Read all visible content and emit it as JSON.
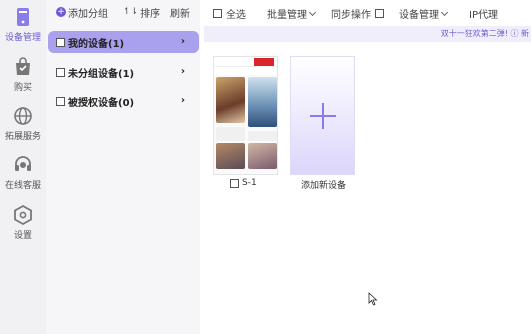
{
  "rail": {
    "items": [
      {
        "label": "设备管理",
        "icon": "phone-device-icon",
        "active": true
      },
      {
        "label": "购买",
        "icon": "shopping-bag-icon"
      },
      {
        "label": "拓展服务",
        "icon": "globe-icon"
      },
      {
        "label": "在线客服",
        "icon": "headset-icon"
      },
      {
        "label": "设置",
        "icon": "hexagon-gear-icon"
      }
    ]
  },
  "groups": {
    "add_label": "添加分组",
    "sort_label": "排序",
    "refresh_label": "刷新",
    "sort_icon": "↿⇂",
    "items": [
      {
        "label": "我的设备(1)",
        "active": true
      },
      {
        "label": "未分组设备(1)"
      },
      {
        "label": "被授权设备(0)"
      }
    ],
    "chevron": "›"
  },
  "toolbar": {
    "select_all": "全选",
    "batch": "批量管理",
    "sync": "同步操作",
    "device_mgmt": "设备管理",
    "ip_proxy": "IP代理"
  },
  "notice": {
    "text": "双十一狂欢第二弹! ⓘ 新"
  },
  "devices": [
    {
      "label": "S-1"
    }
  ],
  "add_device_label": "添加新设备",
  "colors": {
    "accent": "#6b5cd6",
    "group_active": "#a9a0ee"
  }
}
